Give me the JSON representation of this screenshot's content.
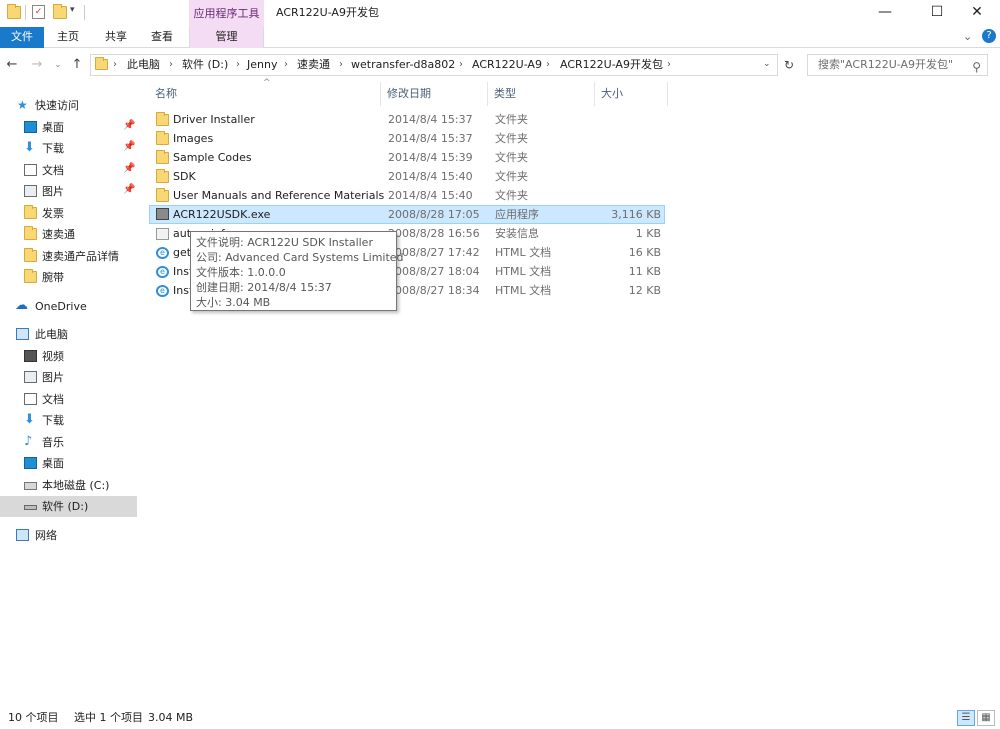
{
  "window": {
    "title": "ACR122U-A9开发包",
    "context_tab_header": "应用程序工具",
    "controls": {
      "minimize": "—",
      "maximize": "☐",
      "close": "✕"
    }
  },
  "ribbon": {
    "tabs": [
      "文件",
      "主页",
      "共享",
      "查看",
      "管理"
    ],
    "help": "?",
    "collapse": "⌄"
  },
  "address": {
    "crumbs": [
      "此电脑",
      "软件 (D:)",
      "Jenny",
      "速卖通",
      "wetransfer-d8a802",
      "ACR122U-A9",
      "ACR122U-A9开发包"
    ],
    "search_placeholder": "搜索\"ACR122U-A9开发包\""
  },
  "nav_pane": {
    "quick_access": "快速访问",
    "quick_items": [
      "桌面",
      "下载",
      "文档",
      "图片",
      "发票",
      "速卖通",
      "速卖通产品详情",
      "腕带"
    ],
    "onedrive": "OneDrive",
    "this_pc": "此电脑",
    "pc_items": [
      "视频",
      "图片",
      "文档",
      "下载",
      "音乐",
      "桌面",
      "本地磁盘 (C:)",
      "软件 (D:)"
    ],
    "network": "网络"
  },
  "columns": {
    "name": "名称",
    "date": "修改日期",
    "type": "类型",
    "size": "大小"
  },
  "files": [
    {
      "name": "Driver Installer",
      "date": "2014/8/4 15:37",
      "type": "文件夹",
      "size": "",
      "icon": "folder-icon"
    },
    {
      "name": "Images",
      "date": "2014/8/4 15:37",
      "type": "文件夹",
      "size": "",
      "icon": "folder-icon"
    },
    {
      "name": "Sample Codes",
      "date": "2014/8/4 15:39",
      "type": "文件夹",
      "size": "",
      "icon": "folder-icon"
    },
    {
      "name": "SDK",
      "date": "2014/8/4 15:40",
      "type": "文件夹",
      "size": "",
      "icon": "folder-icon"
    },
    {
      "name": "User Manuals and Reference Materials",
      "date": "2014/8/4 15:40",
      "type": "文件夹",
      "size": "",
      "icon": "folder-icon"
    },
    {
      "name": "ACR122USDK.exe",
      "date": "2008/8/28 17:05",
      "type": "应用程序",
      "size": "3,116 KB",
      "icon": "exe-icon"
    },
    {
      "name": "aut",
      "name_tail": "inf",
      "date": "2008/8/28 16:56",
      "type": "安装信息",
      "size": "1 KB",
      "icon": "setup-info-icon"
    },
    {
      "name": "get",
      "date": "2008/8/27 17:42",
      "type": "HTML 文档",
      "size": "16 KB",
      "icon": "ie-icon"
    },
    {
      "name": "Inst",
      "date": "2008/8/27 18:04",
      "type": "HTML 文档",
      "size": "11 KB",
      "icon": "ie-icon"
    },
    {
      "name": "Inst",
      "date": "2008/8/27 18:34",
      "type": "HTML 文档",
      "size": "12 KB",
      "icon": "ie-icon"
    }
  ],
  "tooltip": {
    "lines": [
      "文件说明: ACR122U SDK Installer",
      "公司: Advanced Card Systems Limited",
      "文件版本: 1.0.0.0",
      "创建日期: 2014/8/4 15:37",
      "大小: 3.04 MB"
    ]
  },
  "status": {
    "count": "10 个项目",
    "selection": "选中 1 个项目",
    "selection_size": "3.04 MB"
  },
  "colors": {
    "file_tab": "#1979ca",
    "context_tab": "#f4dcf5",
    "selection": "#cce8ff",
    "folder": "#f8d775"
  }
}
